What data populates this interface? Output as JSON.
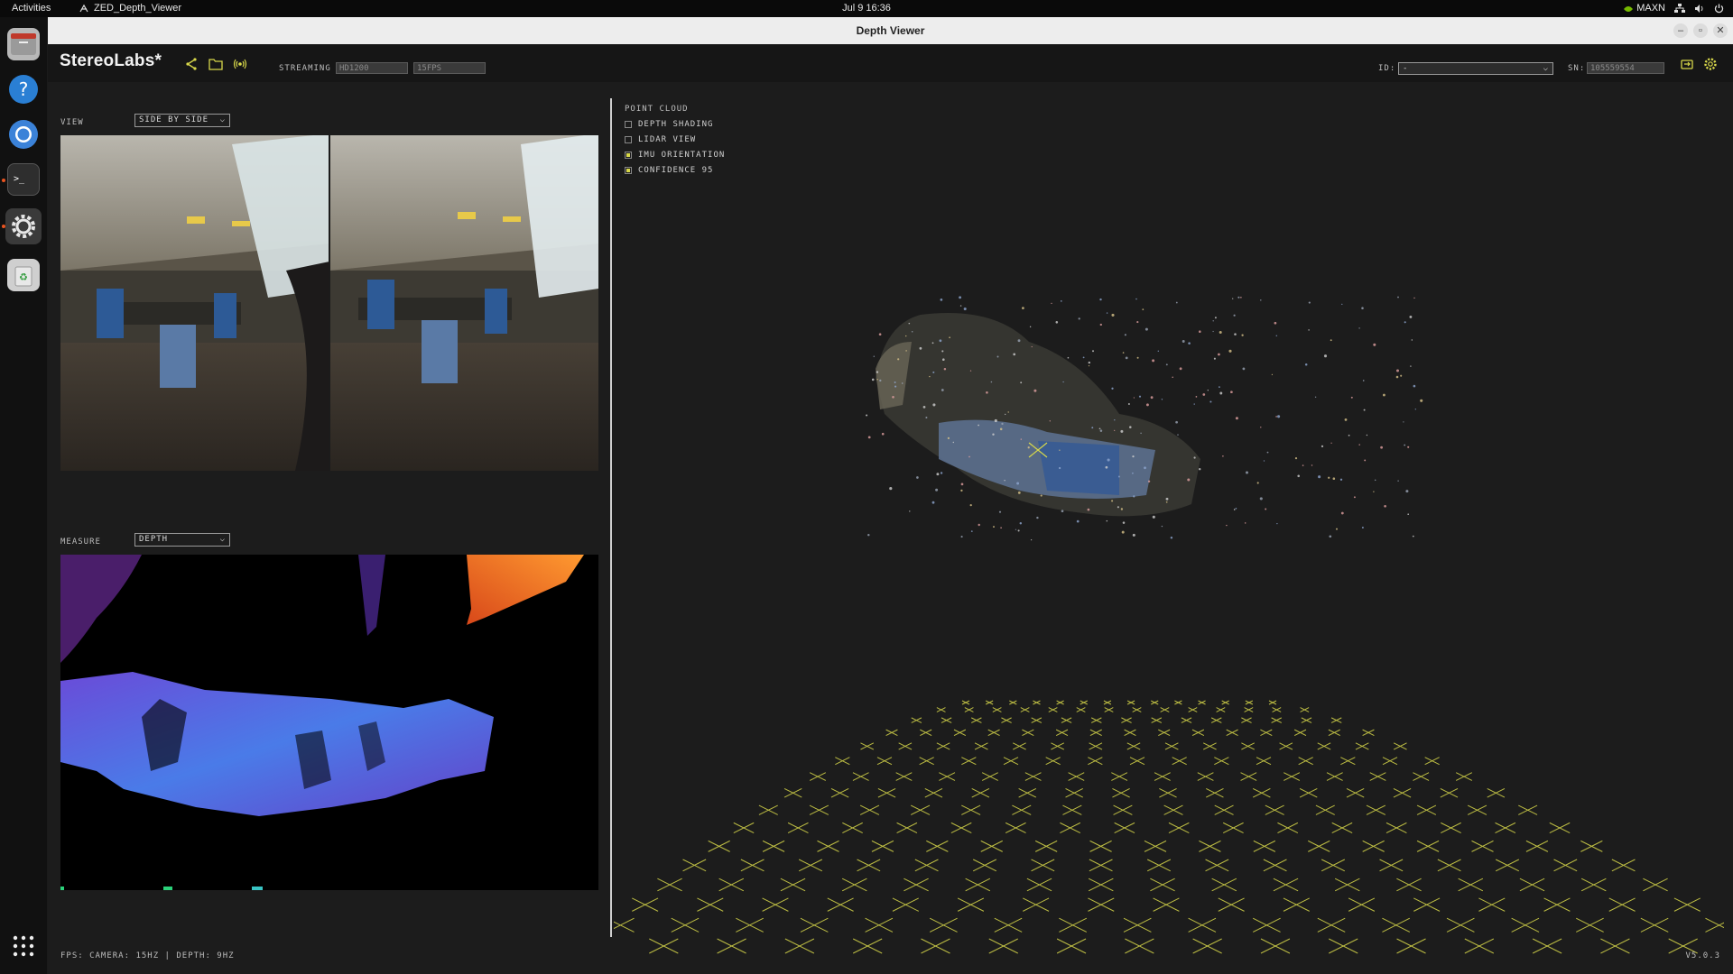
{
  "topbar": {
    "activities": "Activities",
    "app_name": "ZED_Depth_Viewer",
    "clock": "Jul 9  16:36",
    "power_mode": "MAXN"
  },
  "dock": {
    "apps": [
      "files-icon",
      "help-icon",
      "chromium-icon",
      "terminal-icon",
      "settings-icon",
      "trash-icon",
      "app-grid-icon"
    ]
  },
  "window": {
    "title": "Depth Viewer",
    "buttons": [
      "–",
      "▫",
      "✕"
    ]
  },
  "toolbar": {
    "brand": "StereoLabs*",
    "streaming_label": "STREAMING",
    "resolution_value": "HD1200",
    "fps_value": "15FPS",
    "id_label": "ID:",
    "id_value": "-",
    "sn_label": "SN:",
    "sn_value": "105559554"
  },
  "left": {
    "view_label": "VIEW",
    "view_value": "SIDE BY SIDE",
    "measure_label": "MEASURE",
    "measure_value": "DEPTH"
  },
  "point_cloud": {
    "title": "POINT CLOUD",
    "options": [
      {
        "label": "DEPTH SHADING",
        "checked": false
      },
      {
        "label": "LIDAR VIEW",
        "checked": false
      },
      {
        "label": "IMU ORIENTATION",
        "checked": true
      },
      {
        "label": "CONFIDENCE 95",
        "checked": true
      }
    ]
  },
  "status": {
    "fps_text": "FPS: CAMERA: 15HZ | DEPTH: 9HZ",
    "version": "V5.0.3"
  },
  "colors": {
    "accent": "#d8d84a",
    "background": "#1c1c1c",
    "depth_near": "#4a7be8",
    "depth_far": "#f06a1a"
  }
}
